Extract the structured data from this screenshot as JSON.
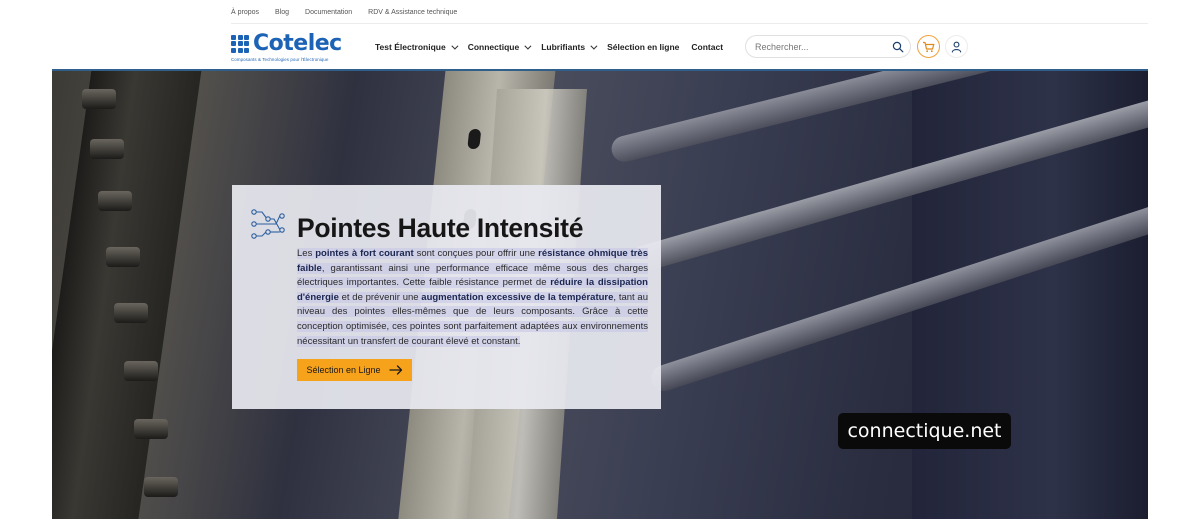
{
  "topbar": {
    "links": [
      "À propos",
      "Blog",
      "Documentation",
      "RDV & Assistance technique"
    ]
  },
  "header": {
    "logo_word": "Cotelec",
    "logo_tagline": "Composants & Technologies pour l'Électronique",
    "nav": [
      "Test Électronique",
      "Connectique",
      "Lubrifiants",
      "Sélection en ligne",
      "Contact"
    ],
    "search_placeholder": "Rechercher...",
    "brand_color": "#1c63b6",
    "cart_ring_color": "#f0a23a"
  },
  "hero": {
    "title": "Pointes Haute Intensité",
    "paragraph": {
      "t1": "Les ",
      "b1": "pointes à fort courant",
      "t2": " sont conçues pour offrir une ",
      "b2": "résistance ohmique très faible",
      "t3": ", garantissant ainsi une performance efficace même sous des charges électriques importantes. Cette faible résistance permet de ",
      "b3": "réduire la dissipation d'énergie",
      "t4": " et de prévenir une ",
      "b4": "augmentation excessive de la température",
      "t5": ", tant au niveau des pointes elles-mêmes que de leurs composants. Grâce à cette conception optimisée, ces pointes sont parfaitement adaptées aux environnements nécessitant un transfert de courant élevé et constant."
    },
    "cta_label": "Sélection en Ligne",
    "cta_color": "#f7a21b",
    "watermark": "connectique.net"
  },
  "icons": [
    "search-icon",
    "cart-icon",
    "user-icon",
    "circuit-icon",
    "arrow-right-icon",
    "chevron-down-icon"
  ]
}
